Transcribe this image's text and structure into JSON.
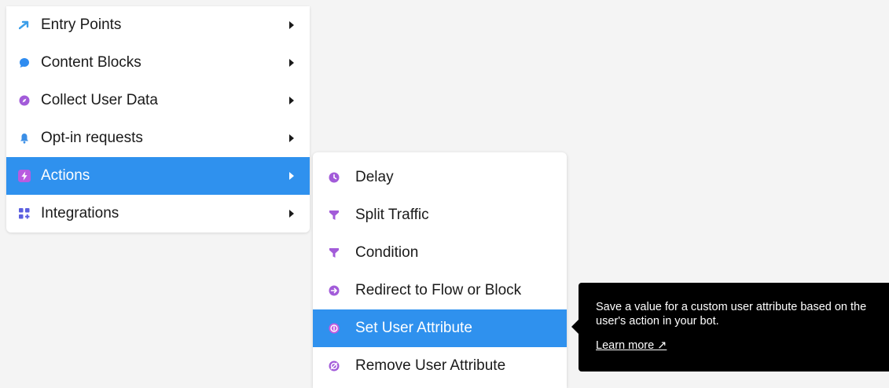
{
  "primary_menu": {
    "items": [
      {
        "label": "Entry Points",
        "icon": "entry-arrow-icon"
      },
      {
        "label": "Content Blocks",
        "icon": "chat-bubble-icon"
      },
      {
        "label": "Collect User Data",
        "icon": "compass-icon"
      },
      {
        "label": "Opt-in requests",
        "icon": "bell-icon"
      },
      {
        "label": "Actions",
        "icon": "lightning-icon",
        "active": true
      },
      {
        "label": "Integrations",
        "icon": "grid-plus-icon"
      }
    ]
  },
  "submenu": {
    "items": [
      {
        "label": "Delay",
        "icon": "clock-icon"
      },
      {
        "label": "Split Traffic",
        "icon": "funnel-icon"
      },
      {
        "label": "Condition",
        "icon": "funnel-icon"
      },
      {
        "label": "Redirect to Flow or Block",
        "icon": "redirect-arrow-icon"
      },
      {
        "label": "Set User Attribute",
        "icon": "set-attribute-icon",
        "active": true
      },
      {
        "label": "Remove User Attribute",
        "icon": "remove-attribute-icon"
      }
    ]
  },
  "tooltip": {
    "description": "Save a value for a custom user attribute based on the user's action in your bot.",
    "link_label": "Learn more ↗"
  },
  "colors": {
    "active_bg": "#2f91ee",
    "icon_purple": "#a25bd9",
    "icon_blue": "#2f91ee",
    "tooltip_bg": "#000000"
  }
}
